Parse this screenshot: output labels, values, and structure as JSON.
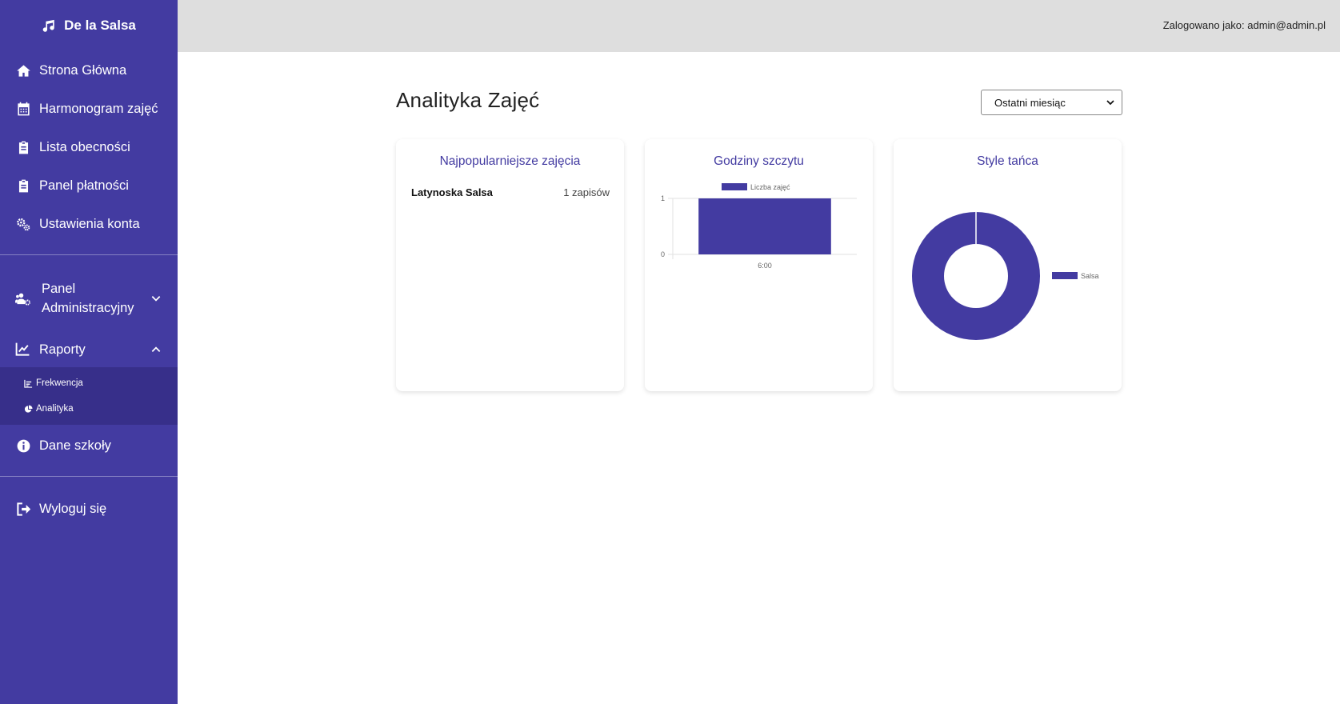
{
  "sidebar": {
    "brand": "De la Salsa",
    "items": [
      {
        "label": "Strona Główna",
        "icon": "home-icon"
      },
      {
        "label": "Harmonogram zajęć",
        "icon": "calendar-icon"
      },
      {
        "label": "Lista obecności",
        "icon": "clipboard-icon"
      },
      {
        "label": "Panel płatności",
        "icon": "clipboard-icon"
      },
      {
        "label": "Ustawienia konta",
        "icon": "gears-icon"
      }
    ],
    "admin_panel": "Panel Administracyjny",
    "reports": "Raporty",
    "sub_items": [
      {
        "label": "Frekwencja",
        "icon": "chart-bar-icon"
      },
      {
        "label": "Analityka",
        "icon": "chart-pie-icon"
      }
    ],
    "school_data": "Dane szkoły",
    "logout": "Wyloguj się",
    "colors": {
      "background": "#433ba1",
      "submenu": "#372f8a"
    }
  },
  "header": {
    "logged_in": "Zalogowano jako: admin@admin.pl"
  },
  "main": {
    "title": "Analityka Zajęć",
    "period_select": {
      "selected": "Ostatni miesiąc"
    },
    "cards": {
      "popular": {
        "title": "Najpopularniejsze zajęcia",
        "rows": [
          {
            "name": "Latynoska Salsa",
            "count": "1 zapisów"
          }
        ]
      },
      "peak_hours": {
        "title": "Godziny szczytu"
      },
      "dance_styles": {
        "title": "Style tańca"
      }
    },
    "accent_color": "#433ba1"
  },
  "chart_data": [
    {
      "type": "bar",
      "categories": [
        "6:00"
      ],
      "series": [
        {
          "name": "Liczba zajęć",
          "values": [
            1
          ]
        }
      ],
      "ylim": [
        0,
        1
      ],
      "yticks": [
        "0",
        "1"
      ],
      "legend": "top",
      "grid": true,
      "color": "#433ba1"
    },
    {
      "type": "pie",
      "variant": "doughnut",
      "labels": [
        "Salsa"
      ],
      "values": [
        1
      ],
      "legend": "right",
      "color": "#433ba1"
    }
  ]
}
